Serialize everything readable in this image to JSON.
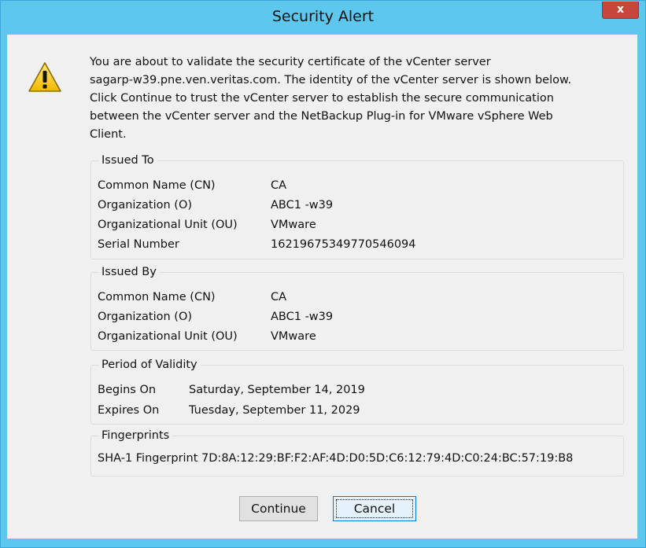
{
  "window": {
    "title": "Security Alert",
    "close_glyph": "x",
    "warning_icon": "warning-triangle-icon"
  },
  "message": "You are about to validate the security certificate of the vCenter server\nsagarp-w39.pne.ven.veritas.com. The identity of the vCenter server is shown below.\nClick Continue to trust the vCenter server to establish the secure communication\nbetween the vCenter server and the NetBackup Plug-in for VMware vSphere Web\nClient.",
  "issued_to": {
    "label": "Issued To",
    "rows": [
      {
        "name": "Common Name (CN)",
        "value": "CA"
      },
      {
        "name": "Organization (O)",
        "value": "ABC1 -w39"
      },
      {
        "name": "Organizational Unit (OU)",
        "value": "VMware"
      },
      {
        "name": "Serial Number",
        "value": "16219675349770546094"
      }
    ]
  },
  "issued_by": {
    "label": "Issued By",
    "rows": [
      {
        "name": "Common Name (CN)",
        "value": "CA"
      },
      {
        "name": "Organization (O)",
        "value": "ABC1 -w39"
      },
      {
        "name": "Organizational Unit (OU)",
        "value": "VMware"
      }
    ]
  },
  "validity": {
    "label": "Period of Validity",
    "rows": [
      {
        "name": "Begins On",
        "value": "Saturday, September 14, 2019"
      },
      {
        "name": "Expires On",
        "value": "Tuesday, September 11, 2029"
      }
    ]
  },
  "fingerprints": {
    "label": "Fingerprints",
    "text": "SHA-1 Fingerprint 7D:8A:12:29:BF:F2:AF:4D:D0:5D:C6:12:79:4D:C0:24:BC:57:19:B8"
  },
  "buttons": {
    "continue": "Continue",
    "cancel": "Cancel"
  }
}
